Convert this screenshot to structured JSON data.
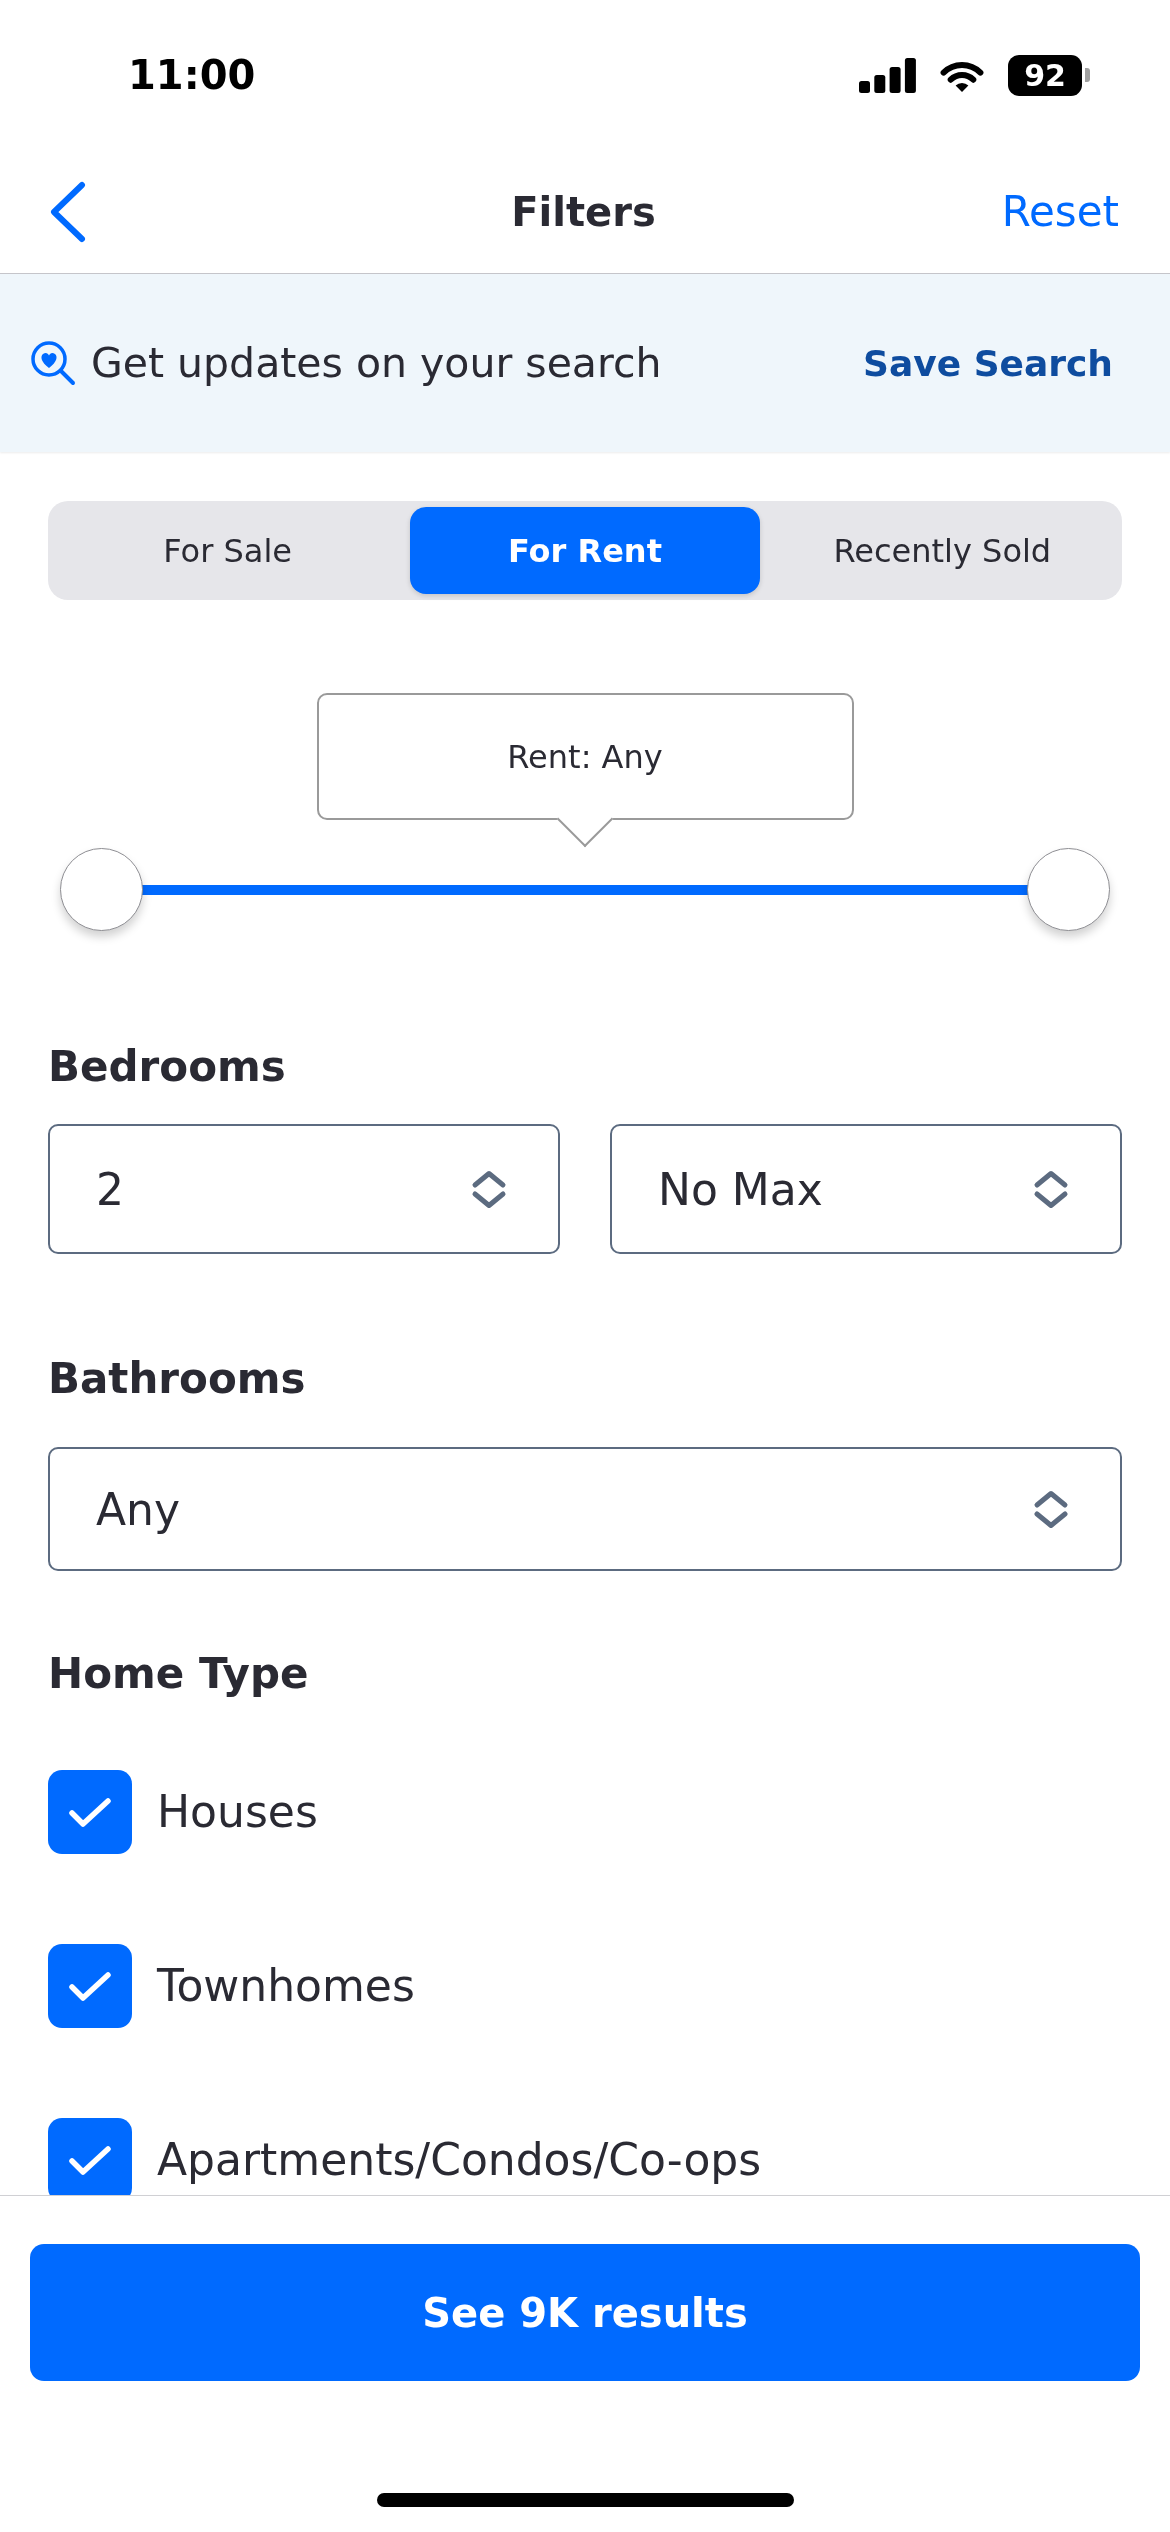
{
  "status_bar": {
    "time": "11:00",
    "battery": "92"
  },
  "header": {
    "title": "Filters",
    "action": "Reset"
  },
  "banner": {
    "text": "Get updates on your search",
    "action": "Save Search"
  },
  "listing_tabs": [
    {
      "label": "For Sale",
      "selected": false
    },
    {
      "label": "For Rent",
      "selected": true
    },
    {
      "label": "Recently Sold",
      "selected": false
    }
  ],
  "price_slider": {
    "tooltip": "Rent: Any",
    "thumbs": [
      {
        "level": 0
      },
      {
        "level": 1
      }
    ]
  },
  "bedrooms": {
    "heading": "Bedrooms",
    "fields": [
      {
        "value": "2"
      },
      {
        "value": "No Max"
      }
    ]
  },
  "bathrooms": {
    "heading": "Bathrooms",
    "fields": [
      {
        "value": "Any"
      }
    ]
  },
  "home_type": {
    "heading": "Home Type",
    "options": [
      {
        "label": "Houses",
        "checked": true
      },
      {
        "label": "Townhomes",
        "checked": true
      },
      {
        "label": "Apartments/Condos/Co-ops",
        "checked": true
      }
    ]
  },
  "results_button": "See 9K results"
}
